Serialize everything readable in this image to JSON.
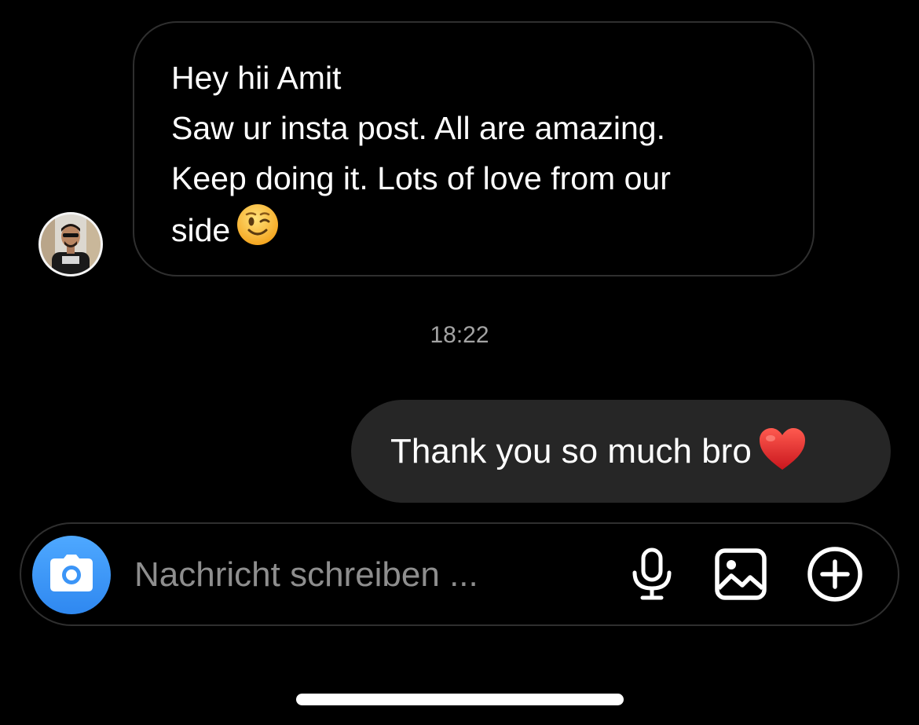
{
  "conversation": {
    "incoming": {
      "lines": [
        "Hey hii Amit",
        "Saw ur insta post. All are amazing.",
        "Keep doing it. Lots of love from our",
        "side"
      ],
      "emoji": "winking-face-emoji"
    },
    "timestamp": "18:22",
    "outgoing": {
      "text": "Thank you so much bro",
      "emoji": "red-heart-emoji"
    }
  },
  "composer": {
    "placeholder": "Nachricht schreiben ...",
    "value": "",
    "icons": [
      "camera-icon",
      "microphone-icon",
      "gallery-icon",
      "plus-circle-icon"
    ]
  },
  "colors": {
    "background": "#000000",
    "outgoing_bubble": "#262626",
    "bubble_border": "#2f2f2f",
    "camera_button": "#3b95f7",
    "timestamp": "#a3a3a3",
    "placeholder": "#8e8e8e"
  }
}
